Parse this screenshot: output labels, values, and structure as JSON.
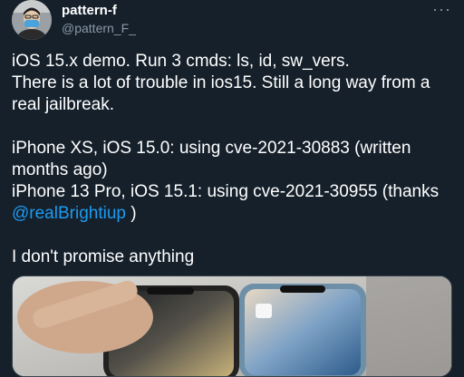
{
  "author": {
    "name": "pattern-f",
    "handle": "@pattern_F_"
  },
  "more_label": "···",
  "tweet": {
    "line1": "iOS 15.x demo. Run 3 cmds: ls, id, sw_vers.",
    "line2": "There is a lot of trouble in ios15. Still a long way from a",
    "line3": "real jailbreak.",
    "line4": "iPhone XS, iOS 15.0: using cve-2021-30883 (written",
    "line5": "months ago)",
    "line6": "iPhone 13 Pro, iOS 15.1: using cve-2021-30955 (thanks",
    "mention": "@realBrightiup",
    "mention_suffix": " )",
    "line8": "I don't promise anything"
  },
  "colors": {
    "background": "#15202b",
    "text": "#ffffff",
    "secondary": "#8b98a5",
    "link": "#1d9bf0"
  }
}
